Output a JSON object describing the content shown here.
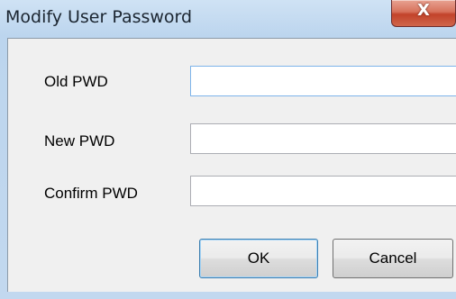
{
  "window": {
    "title": "Modify User Password",
    "close_glyph": "X"
  },
  "form": {
    "old_pwd_label": "Old PWD",
    "old_pwd_value": "",
    "new_pwd_label": "New PWD",
    "new_pwd_value": "",
    "confirm_pwd_label": "Confirm PWD",
    "confirm_pwd_value": ""
  },
  "buttons": {
    "ok_label": "OK",
    "cancel_label": "Cancel"
  },
  "icons": {
    "close": "close-icon"
  },
  "colors": {
    "titlebar": "#bcd5ee",
    "close_button": "#c2432a",
    "focused_border": "#7eb4ea"
  }
}
